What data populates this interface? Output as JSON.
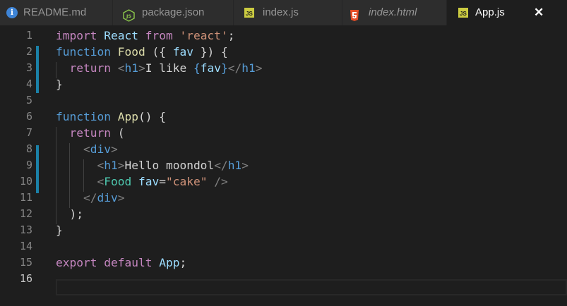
{
  "tabs": [
    {
      "label": "README.md",
      "icon": "info-icon",
      "active": false,
      "italic": false
    },
    {
      "label": "package.json",
      "icon": "nodejs-icon",
      "active": false,
      "italic": false
    },
    {
      "label": "index.js",
      "icon": "js-icon",
      "active": false,
      "italic": false
    },
    {
      "label": "index.html",
      "icon": "html5-icon",
      "active": false,
      "italic": true
    },
    {
      "label": "App.js",
      "icon": "js-icon",
      "active": true,
      "italic": false
    }
  ],
  "close_glyph": "✕",
  "icon_text": {
    "info": "i",
    "js": "JS"
  },
  "line_numbers": [
    "1",
    "2",
    "3",
    "4",
    "5",
    "6",
    "7",
    "8",
    "9",
    "10",
    "11",
    "12",
    "13",
    "14",
    "15",
    "16"
  ],
  "current_line": "16",
  "colors": {
    "background": "#1e1e1e",
    "tabbar": "#252526",
    "keyword": "#569cd6",
    "control": "#c586c0",
    "function": "#dcdcaa",
    "variable": "#9cdcfe",
    "string": "#ce9178",
    "component": "#4ec9b0",
    "gutter_modified": "#1b81a8"
  },
  "code": {
    "l1": {
      "t1": "import",
      "t2": "React",
      "t3": "from",
      "t4": "'react'",
      "t5": ";"
    },
    "l2": {
      "t1": "function",
      "t2": "Food",
      "t3": "({",
      "t4": "fav",
      "t5": "}) {"
    },
    "l3": {
      "t1": "return",
      "t2": "<",
      "t3": "h1",
      "t4": ">",
      "t5": "I like ",
      "t6": "{",
      "t7": "fav",
      "t8": "}",
      "t9": "</",
      "t10": "h1",
      "t11": ">"
    },
    "l4": {
      "t1": "}"
    },
    "l6": {
      "t1": "function",
      "t2": "App",
      "t3": "() {"
    },
    "l7": {
      "t1": "return",
      "t2": "("
    },
    "l8": {
      "t1": "<",
      "t2": "div",
      "t3": ">"
    },
    "l9": {
      "t1": "<",
      "t2": "h1",
      "t3": ">",
      "t4": "Hello moondol",
      "t5": "</",
      "t6": "h1",
      "t7": ">"
    },
    "l10": {
      "t1": "<",
      "t2": "Food",
      "t3": "fav",
      "t4": "=",
      "t5": "\"cake\"",
      "t6": "/>"
    },
    "l11": {
      "t1": "</",
      "t2": "div",
      "t3": ">"
    },
    "l12": {
      "t1": ");"
    },
    "l13": {
      "t1": "}"
    },
    "l15": {
      "t1": "export",
      "t2": "default",
      "t3": "App",
      "t4": ";"
    }
  }
}
